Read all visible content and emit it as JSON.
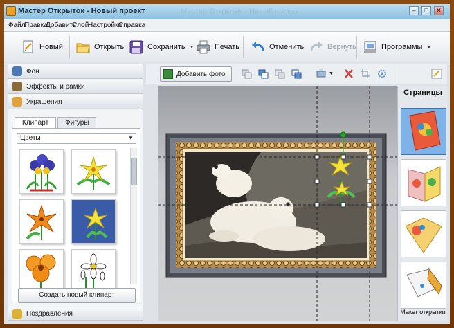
{
  "window": {
    "title": "Мастер Открыток - Новый проект",
    "title_ghost": "Мастер Открыток - Новый проект",
    "controls": {
      "minimize": "–",
      "maximize": "□",
      "close": "✕"
    }
  },
  "menu": [
    "Файл",
    "Правка",
    "Добавить",
    "Слой",
    "Настройки",
    "Справка"
  ],
  "toolbar": {
    "new_label": "Новый",
    "open_label": "Открыть",
    "save_label": "Сохранить",
    "print_label": "Печать",
    "undo_label": "Отменить",
    "redo_label": "Вернуть",
    "programs_label": "Программы"
  },
  "left_panel": {
    "sections": {
      "background": "Фон",
      "effects": "Эффекты и рамки",
      "decorations": "Украшения",
      "greetings": "Поздравления"
    },
    "tabs": {
      "clipart": "Клипарт",
      "shapes": "Фигуры"
    },
    "category_select": "Цветы",
    "create_button": "Создать новый клипарт"
  },
  "center": {
    "add_photo_label": "Добавить фото"
  },
  "right_panel": {
    "title": "Страницы",
    "layout_label": "Макет открытки"
  },
  "colors": {
    "accent": "#7fb2e6",
    "frame": "#7a3d08",
    "selection_handle": "#2aa52a"
  }
}
